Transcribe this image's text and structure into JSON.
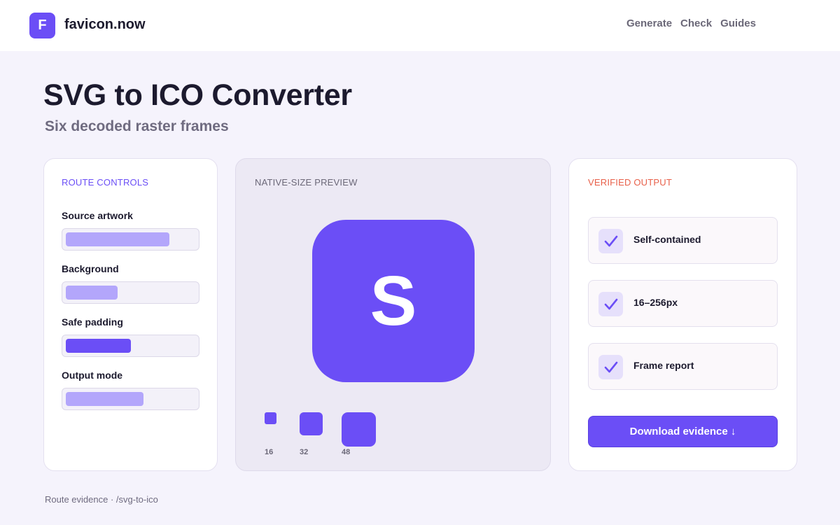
{
  "header": {
    "logo_letter": "F",
    "brand": "favicon.now",
    "nav": [
      "Generate",
      "Check",
      "Guides"
    ]
  },
  "hero": {
    "title": "SVG to ICO Converter",
    "subtitle": "Six decoded raster frames"
  },
  "controls": {
    "heading": "ROUTE CONTROLS",
    "items": [
      {
        "label": "Source artwork",
        "level": 0.8,
        "color": "#b3a6fb"
      },
      {
        "label": "Background",
        "level": 0.4,
        "color": "#b3a6fb"
      },
      {
        "label": "Safe padding",
        "level": 0.5,
        "color": "#6b4ef6"
      },
      {
        "label": "Output mode",
        "level": 0.6,
        "color": "#b3a6fb"
      }
    ]
  },
  "preview": {
    "heading": "NATIVE-SIZE PREVIEW",
    "glyph": "S",
    "sizes": [
      "16",
      "32",
      "48"
    ]
  },
  "output": {
    "heading": "VERIFIED OUTPUT",
    "checks": [
      "Self-contained",
      "16–256px",
      "Frame report"
    ],
    "download_label": "Download evidence ↓"
  },
  "footer": {
    "text": "Route evidence · /svg-to-ico"
  },
  "colors": {
    "accent": "#6b4ef6",
    "accent_light": "#b3a6fb",
    "warning_label": "#e8604a"
  }
}
